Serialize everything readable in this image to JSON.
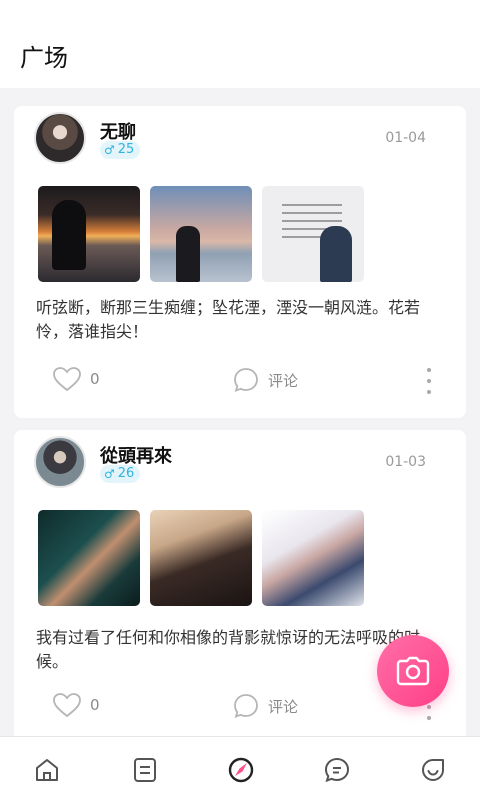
{
  "header": {
    "title": "广场"
  },
  "posts": [
    {
      "username": "无聊",
      "gender_icon": "male-icon",
      "gender_symbol": "♂",
      "age": "25",
      "date": "01-04",
      "images": [
        "sunset-silhouette-photo",
        "beach-dusk-photo",
        "text-card-photo"
      ],
      "text": "听弦断，断那三生痴缠；坠花湮，湮没一朝风涟。花若怜，落谁指尖！",
      "likes": "0",
      "comment_label": "评论"
    },
    {
      "username": "從頭再來",
      "gender_icon": "male-icon",
      "gender_symbol": "♂",
      "age": "26",
      "date": "01-03",
      "images": [
        "movie-still-photo",
        "roses-photo",
        "anime-girl-photo"
      ],
      "text": "我有过看了任何和你相像的背影就惊讶的无法呼吸的时候。",
      "likes": "0",
      "comment_label": "评论"
    }
  ],
  "fab": {
    "icon": "camera-icon"
  },
  "bottom_nav": {
    "items": [
      {
        "icon": "home-icon"
      },
      {
        "icon": "list-icon"
      },
      {
        "icon": "plaza-icon",
        "active": true
      },
      {
        "icon": "message-icon"
      },
      {
        "icon": "profile-icon"
      }
    ]
  },
  "colors": {
    "accent_pink": "#ff4f8f",
    "badge_blue": "#2fb4e0",
    "badge_bg": "#e3f5fb",
    "background": "#f3f3f5"
  }
}
